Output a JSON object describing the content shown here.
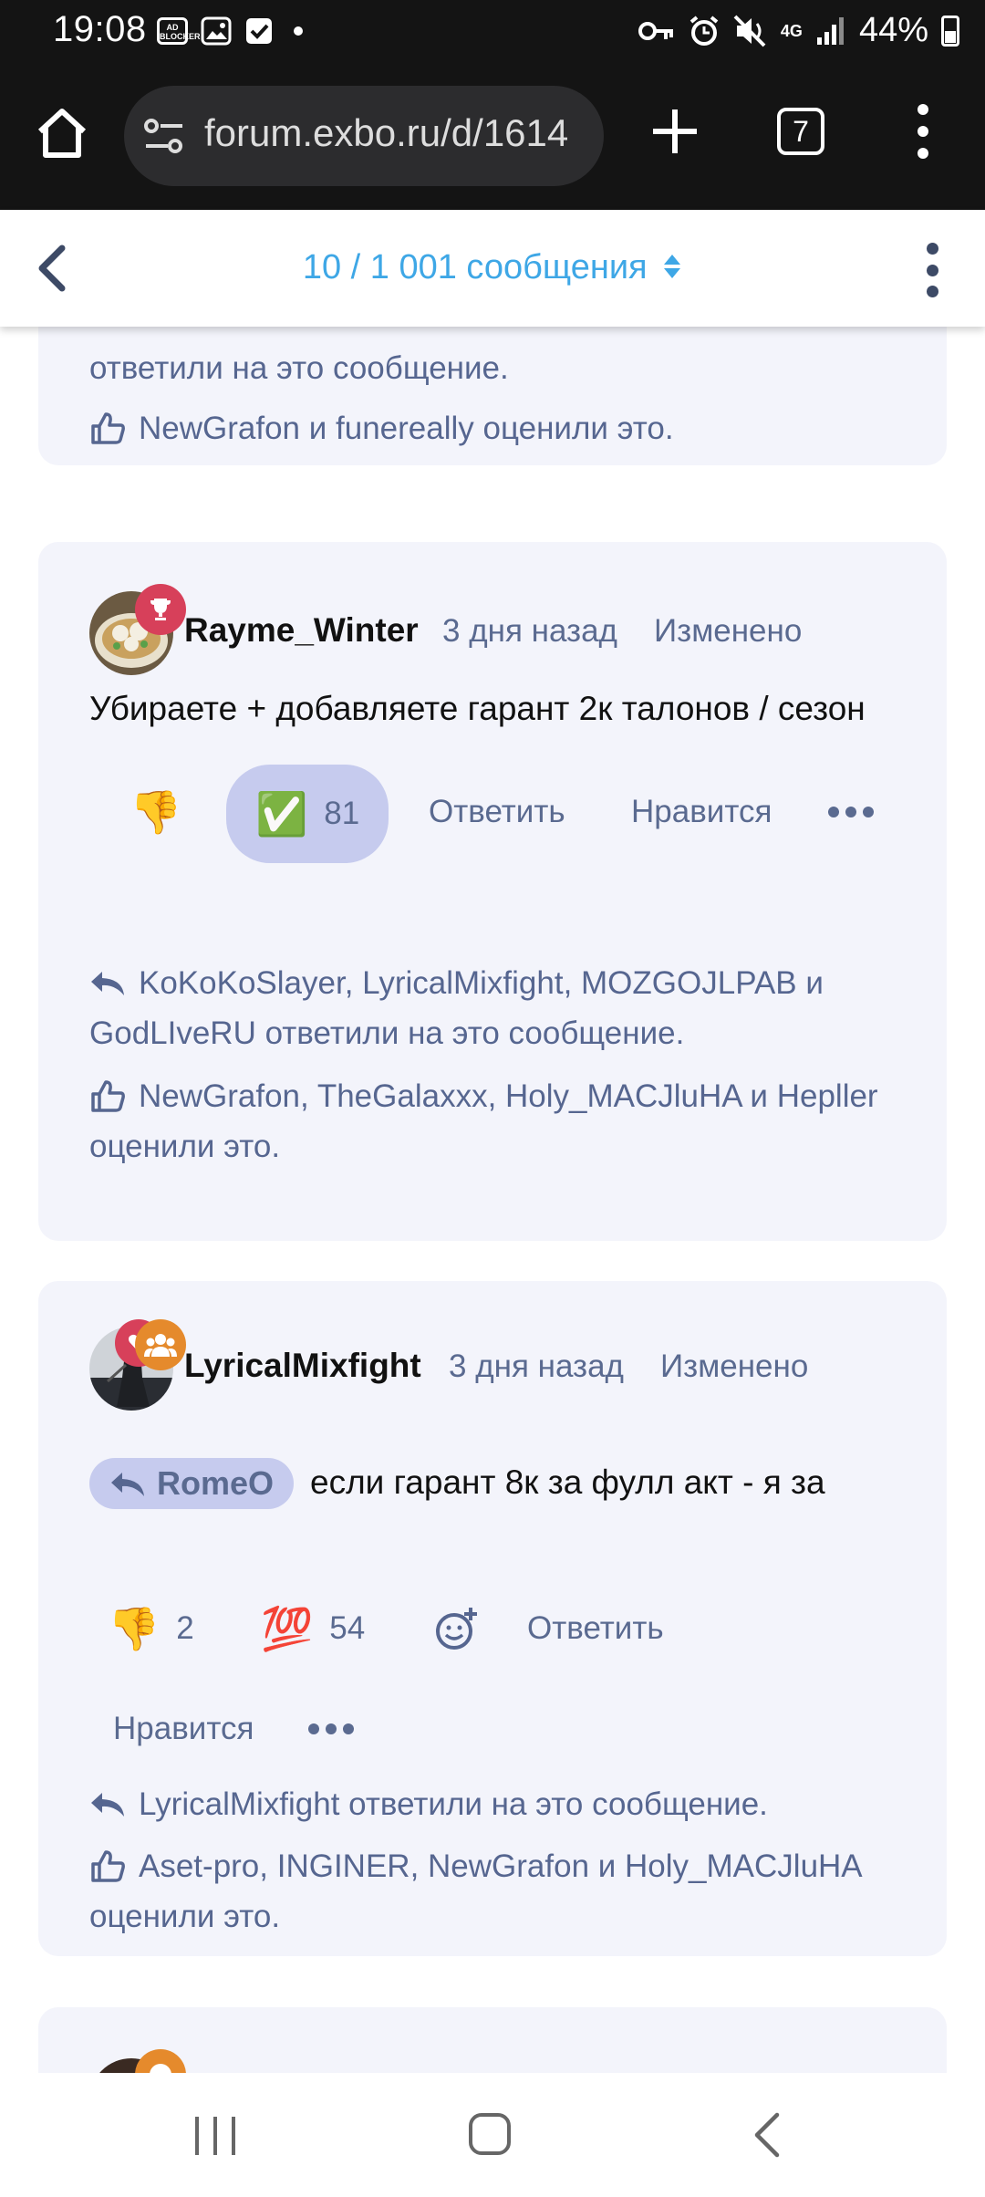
{
  "status_bar": {
    "time": "19:08",
    "battery": "44%",
    "network": "4G",
    "ad_blocker_label": "AD BLOCKER"
  },
  "browser": {
    "url": "forum.exbo.ru/d/1614",
    "tab_count": "7"
  },
  "forum_header": {
    "progress": "10 / 1 001 сообщения"
  },
  "previous_post": {
    "replies_tail": "ответили на это сообщение.",
    "likes": "NewGrafon и funereally оценили это."
  },
  "posts": [
    {
      "username": "Rayme_Winter",
      "time": "3 дня назад",
      "edited": "Изменено",
      "body": "Убираете + добавляете гарант 2к талонов / сезон",
      "actions": {
        "dislike_emoji": "👎",
        "check_emoji": "✅",
        "check_count": "81",
        "reply": "Ответить",
        "like": "Нравится"
      },
      "replies": "KoKoKoSlayer, LyricalMixfight, MOZGOJLPAB и GodLIveRU ответили на это сообщение.",
      "likes": "NewGrafon, TheGalaxxx, Holy_MACJluHA и Hepller оценили это."
    },
    {
      "username": "LyricalMixfight",
      "time": "3 дня назад",
      "edited": "Изменено",
      "mention": "RomeO",
      "body": "если гарант 8к за фулл акт - я за",
      "actions": {
        "dislike_emoji": "👎",
        "dislike_count": "2",
        "hundred_emoji": "💯",
        "hundred_count": "54",
        "reply": "Ответить",
        "like": "Нравится"
      },
      "replies": "LyricalMixfight ответили на это сообщение.",
      "likes": "Aset-pro, INGINER, NewGrafon и Holy_MACJluHA оценили это."
    }
  ],
  "colors": {
    "accent": "#3ea7e6",
    "card_bg": "#f3f4fb",
    "muted_text": "#566690",
    "reaction_bg": "#c6cbee",
    "badge_red": "#d7405a",
    "badge_orange": "#e58a2c"
  }
}
